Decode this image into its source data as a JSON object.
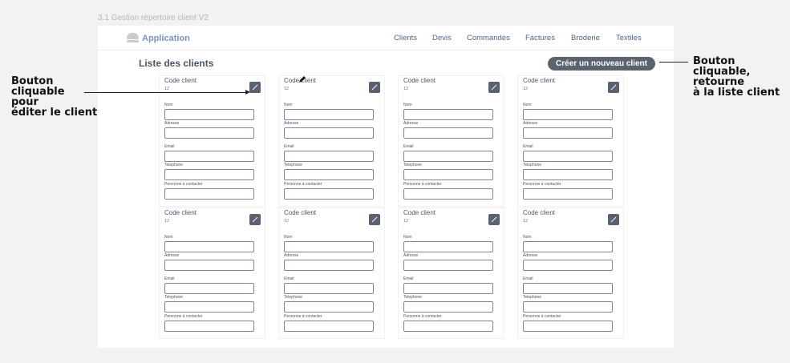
{
  "page_caption": "3.1 Gestion répertoire client V2",
  "app": {
    "title": "Application",
    "logo_icon": "burger-logo-icon"
  },
  "nav": {
    "items": [
      "Clients",
      "Devis",
      "Commandes",
      "Factures",
      "Broderie",
      "Textiles"
    ]
  },
  "list_title": "Liste des clients",
  "create_button": "Créer un nouveau client",
  "card": {
    "code_label": "Code client",
    "code_value": "12",
    "edit_icon": "pencil-icon",
    "fields": [
      "Nom",
      "Adresse",
      "Email",
      "Telephone",
      "Personne à contacter"
    ]
  },
  "annotations": {
    "left": [
      "Bouton",
      "cliquable",
      "pour",
      "éditer le client"
    ],
    "right": [
      "Bouton",
      "cliquable,",
      "retourne",
      "à la liste client"
    ]
  },
  "colors": {
    "button_dark": "#5b6270",
    "nav_link": "#4d6488",
    "app_title": "#7d93b8"
  }
}
